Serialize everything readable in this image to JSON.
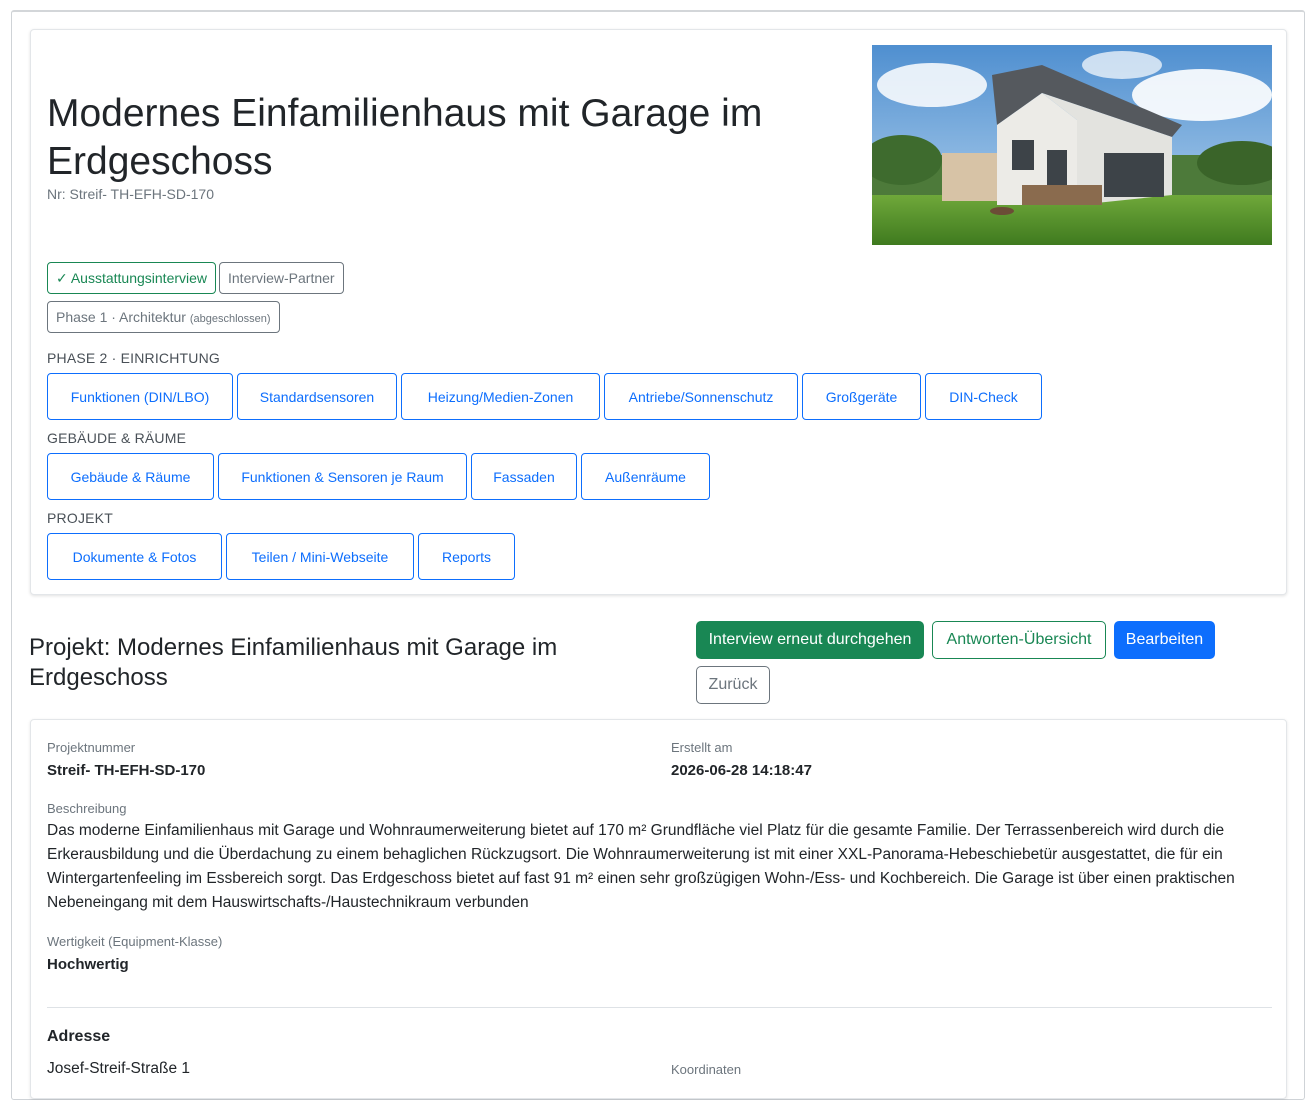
{
  "hero": {
    "title": "Modernes Einfamilienhaus mit Garage im Erdgeschoss",
    "number": "Nr: Streif- TH-EFH-SD-170"
  },
  "status": {
    "interview": "✓ Ausstattungsinterview",
    "partner": "Interview-Partner",
    "phase1": "Phase 1 · Architektur",
    "phase1_note": "(abgeschlossen)"
  },
  "sections": {
    "phase2": {
      "label": "Phase 2 · Einrichtung",
      "buttons": [
        "Funktionen (DIN/LBO)",
        "Standardsensoren",
        "Heizung/Medien-Zonen",
        "Antriebe/Sonnenschutz",
        "Großgeräte",
        "DIN-Check"
      ]
    },
    "gebaeude": {
      "label": "Gebäude & Räume",
      "buttons": [
        "Gebäude & Räume",
        "Funktionen & Sensoren je Raum",
        "Fassaden",
        "Außenräume"
      ]
    },
    "projekt": {
      "label": "Projekt",
      "buttons": [
        "Dokumente & Fotos",
        "Teilen / Mini-Webseite",
        "Reports"
      ]
    }
  },
  "project": {
    "heading": "Projekt: Modernes Einfamilienhaus mit Garage im Erdgeschoss",
    "actions": {
      "interview": "Interview erneut durchgehen",
      "answers": "Antworten-Übersicht",
      "edit": "Bearbeiten",
      "back": "Zurück"
    }
  },
  "details": {
    "number_label": "Projektnummer",
    "number_value": "Streif- TH-EFH-SD-170",
    "created_label": "Erstellt am",
    "created_value": "2026-06-28 14:18:47",
    "description_label": "Beschreibung",
    "description": "Das moderne Einfamilienhaus mit Garage und Wohnraumerweiterung bietet auf 170 m² Grundfläche viel Platz für die gesamte Familie. Der Terrassenbereich wird durch die Erkerausbildung und die Überdachung zu einem behaglichen Rückzugsort. Die Wohnraumerweiterung ist mit einer XXL-Panorama-Hebeschiebetür ausgestattet, die für ein Wintergartenfeeling im Essbereich sorgt. Das Erdgeschoss bietet auf fast 91 m² einen sehr großzügigen Wohn-/Ess- und Kochbereich. Die Garage ist über einen praktischen Nebeneingang mit dem Hauswirtschafts-/Haustechnikraum verbunden",
    "class_label": "Wertigkeit (Equipment-Klasse)",
    "class_value": "Hochwertig",
    "address_heading": "Adresse",
    "address_street": "Josef-Streif-Straße 1",
    "coords_label": "Koordinaten"
  },
  "colors": {
    "primary": "#0d6efd",
    "success": "#198754",
    "secondary": "#6c757d"
  }
}
